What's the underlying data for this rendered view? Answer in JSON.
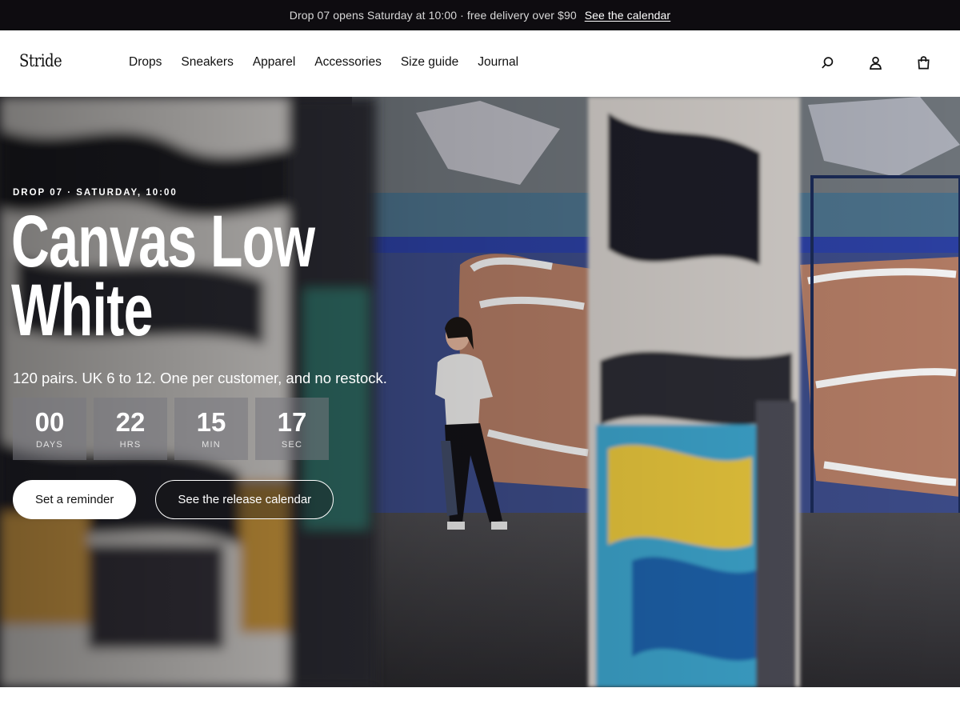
{
  "announcement": {
    "text": "Drop 07 opens Saturday at 10:00 · free delivery over $90",
    "link": "See the calendar"
  },
  "header": {
    "logo": "Stride",
    "nav": [
      "Drops",
      "Sneakers",
      "Apparel",
      "Accessories",
      "Size guide",
      "Journal"
    ],
    "icons": [
      "search-icon",
      "account-icon",
      "bag-icon"
    ]
  },
  "hero": {
    "eyebrow": "DROP 07 · SATURDAY, 10:00",
    "title_line1": "Canvas Low",
    "title_line2": "White",
    "subline": "120 pairs. UK 6 to 12. One per customer, and no restock.",
    "countdown": [
      {
        "value": "00",
        "label": "DAYS"
      },
      {
        "value": "22",
        "label": "HRS"
      },
      {
        "value": "15",
        "label": "MIN"
      },
      {
        "value": "17",
        "label": "SEC"
      }
    ],
    "primary_cta": "Set a reminder",
    "secondary_cta": "See the release calendar"
  },
  "colors": {
    "announcement_bg": "#0e0c10",
    "header_bg": "#ffffff",
    "hero_text": "#ffffff"
  }
}
